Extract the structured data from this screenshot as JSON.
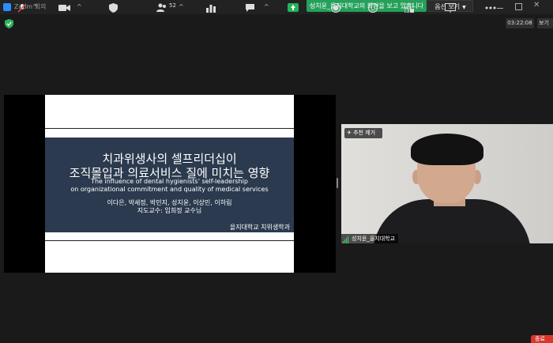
{
  "window": {
    "title": "Zoom 회의"
  },
  "banner": {
    "text": "성치윤_을지대학교의 화면을 보고 있습니다",
    "view_options": "옵션 보기"
  },
  "timer": "03:22:08",
  "view_toggle": "보기",
  "slide": {
    "title_line1": "치과위생사의 셀프리더십이",
    "title_line2": "조직몰입과 의료서비스 질에 미치는 영향",
    "english_line1": "The influence of dental hygienists' self-leadership",
    "english_line2": "on organizational commitment and quality of medical services",
    "authors": "이다은, 박세정, 박민지, 성치윤, 이상민, 이하림",
    "advisor": "지도교수: 임희정 교수님",
    "department": "을지대학교 치위생학과"
  },
  "video": {
    "unpin_label": "추천 제거",
    "participant_name": "성치윤_을지대학교"
  },
  "toolbar": {
    "participants_count": "52",
    "end_label": "종료"
  },
  "colors": {
    "share_banner": "#25a05a",
    "end_button": "#d8362b",
    "slide_panel": "#2b3a4e"
  },
  "icons": [
    "mute-mic-icon",
    "video-camera-icon",
    "security-shield-icon",
    "participants-icon",
    "polls-icon",
    "chat-icon",
    "share-screen-icon",
    "record-icon",
    "reactions-icon",
    "apps-icon",
    "whiteboard-icon",
    "more-icon"
  ]
}
